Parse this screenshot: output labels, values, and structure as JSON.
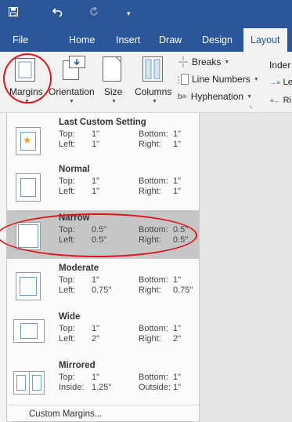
{
  "quick_access": {
    "save_icon": "save-icon",
    "undo_icon": "undo-icon",
    "redo_icon": "redo-icon",
    "customize_icon": "customize-icon"
  },
  "tabs": [
    "File",
    "Home",
    "Insert",
    "Draw",
    "Design",
    "Layout"
  ],
  "active_tab": "Layout",
  "ribbon": {
    "margins_label": "Margins",
    "orientation_label": "Orientation",
    "size_label": "Size",
    "columns_label": "Columns",
    "breaks_label": "Breaks",
    "line_numbers_label": "Line Numbers",
    "hyphenation_label": "Hyphenation",
    "indent_label": "Inder",
    "indent_left_label": "Le",
    "indent_right_label": "Ri"
  },
  "margins_menu": [
    {
      "title": "Last Custom Setting",
      "k1": "Top:",
      "v1": "1\"",
      "k2": "Bottom:",
      "v2": "1\"",
      "k3": "Left:",
      "v3": "1\"",
      "k4": "Right:",
      "v4": "1\""
    },
    {
      "title": "Normal",
      "k1": "Top:",
      "v1": "1\"",
      "k2": "Bottom:",
      "v2": "1\"",
      "k3": "Left:",
      "v3": "1\"",
      "k4": "Right:",
      "v4": "1\""
    },
    {
      "title": "Narrow",
      "k1": "Top:",
      "v1": "0.5\"",
      "k2": "Bottom:",
      "v2": "0.5\"",
      "k3": "Left:",
      "v3": "0.5\"",
      "k4": "Right:",
      "v4": "0.5\""
    },
    {
      "title": "Moderate",
      "k1": "Top:",
      "v1": "1\"",
      "k2": "Bottom:",
      "v2": "1\"",
      "k3": "Left:",
      "v3": "0.75\"",
      "k4": "Right:",
      "v4": "0.75\""
    },
    {
      "title": "Wide",
      "k1": "Top:",
      "v1": "1\"",
      "k2": "Bottom:",
      "v2": "1\"",
      "k3": "Left:",
      "v3": "2\"",
      "k4": "Right:",
      "v4": "2\""
    },
    {
      "title": "Mirrored",
      "k1": "Top:",
      "v1": "1\"",
      "k2": "Bottom:",
      "v2": "1\"",
      "k3": "Inside:",
      "v3": "1.25\"",
      "k4": "Outside:",
      "v4": "1\""
    }
  ],
  "selected_option": "Narrow",
  "custom_margins_label": "Custom Margins...",
  "colors": {
    "ribbon_blue": "#2b579a",
    "highlight": "#c6c6c6",
    "annotation_red": "#e0141c"
  }
}
